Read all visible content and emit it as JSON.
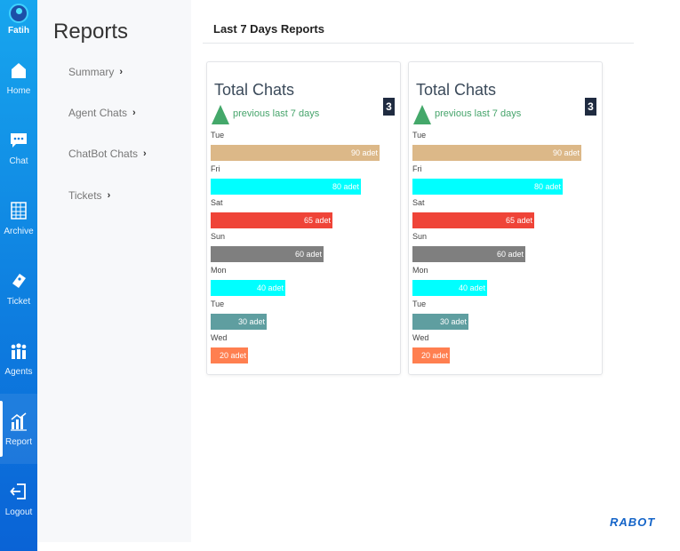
{
  "user": {
    "name": "Fatih"
  },
  "rail": [
    {
      "label": "Home",
      "icon": "home-icon"
    },
    {
      "label": "Chat",
      "icon": "chat-icon"
    },
    {
      "label": "Archive",
      "icon": "archive-icon"
    },
    {
      "label": "Ticket",
      "icon": "ticket-icon"
    },
    {
      "label": "Agents",
      "icon": "agents-icon"
    },
    {
      "label": "Report",
      "icon": "report-icon",
      "active": true
    },
    {
      "label": "Logout",
      "icon": "logout-icon"
    }
  ],
  "subnav": {
    "title": "Reports",
    "items": [
      {
        "label": "Summary"
      },
      {
        "label": "Agent Chats"
      },
      {
        "label": "ChatBot Chats"
      },
      {
        "label": "Tickets"
      }
    ]
  },
  "main": {
    "title": "Last 7 Days Reports"
  },
  "cards": [
    {
      "title": "Total Chats",
      "subtitle": "previous last 7 days",
      "badge": "3",
      "trend_color": "#44a86a",
      "rows": [
        {
          "day": "Tue",
          "value": 90,
          "label": "90 adet",
          "color": "#dcb888"
        },
        {
          "day": "Fri",
          "value": 80,
          "label": "80 adet",
          "color": "#00ffff"
        },
        {
          "day": "Sat",
          "value": 65,
          "label": "65 adet",
          "color": "#ef4438"
        },
        {
          "day": "Sun",
          "value": 60,
          "label": "60 adet",
          "color": "#7f7f7f"
        },
        {
          "day": "Mon",
          "value": 40,
          "label": "40 adet",
          "color": "#00ffff"
        },
        {
          "day": "Tue",
          "value": 30,
          "label": "30 adet",
          "color": "#5f9ea0"
        },
        {
          "day": "Wed",
          "value": 20,
          "label": "20 adet",
          "color": "#ff7f50"
        }
      ]
    },
    {
      "title": "Total Chats",
      "subtitle": "previous last 7 days",
      "badge": "3",
      "trend_color": "#44a86a",
      "rows": [
        {
          "day": "Tue",
          "value": 90,
          "label": "90 adet",
          "color": "#dcb888"
        },
        {
          "day": "Fri",
          "value": 80,
          "label": "80 adet",
          "color": "#00ffff"
        },
        {
          "day": "Sat",
          "value": 65,
          "label": "65 adet",
          "color": "#ef4438"
        },
        {
          "day": "Sun",
          "value": 60,
          "label": "60 adet",
          "color": "#7f7f7f"
        },
        {
          "day": "Mon",
          "value": 40,
          "label": "40 adet",
          "color": "#00ffff"
        },
        {
          "day": "Tue",
          "value": 30,
          "label": "30 adet",
          "color": "#5f9ea0"
        },
        {
          "day": "Wed",
          "value": 20,
          "label": "20 adet",
          "color": "#ff7f50"
        }
      ]
    }
  ],
  "brand": "RABOT"
}
